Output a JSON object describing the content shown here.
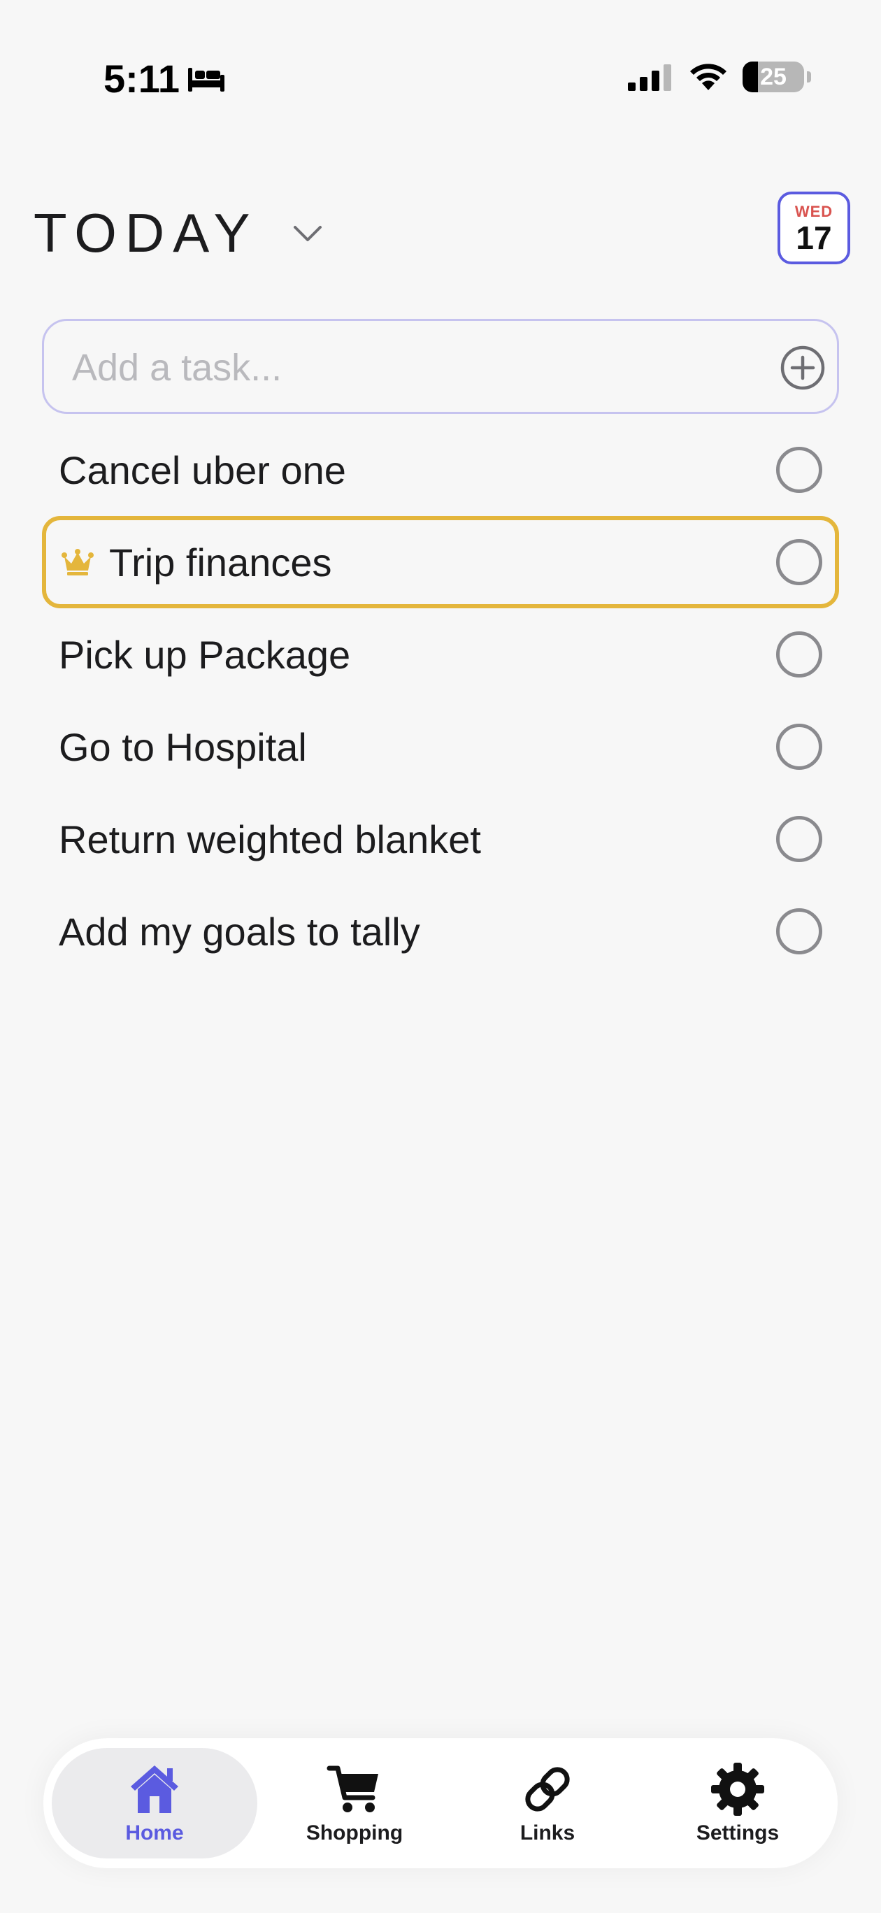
{
  "status_bar": {
    "time": "5:11",
    "battery": "25",
    "battery_level": 0.25
  },
  "header": {
    "title": "TODAY",
    "calendar": {
      "day": "WED",
      "date": "17"
    }
  },
  "add_task": {
    "placeholder": "Add a task..."
  },
  "tasks": [
    {
      "label": "Cancel uber one",
      "highlighted": false
    },
    {
      "label": "Trip finances",
      "highlighted": true
    },
    {
      "label": "Pick up Package",
      "highlighted": false
    },
    {
      "label": "Go to Hospital",
      "highlighted": false
    },
    {
      "label": "Return weighted blanket",
      "highlighted": false
    },
    {
      "label": "Add my goals to tally",
      "highlighted": false
    }
  ],
  "tab_bar": {
    "items": [
      {
        "label": "Home",
        "icon": "house-icon",
        "active": true
      },
      {
        "label": "Shopping",
        "icon": "cart-icon",
        "active": false
      },
      {
        "label": "Links",
        "icon": "link-icon",
        "active": false
      },
      {
        "label": "Settings",
        "icon": "gear-icon",
        "active": false
      }
    ]
  },
  "colors": {
    "accent": "#5b5be0",
    "highlight": "#e4b63c",
    "calendar_day": "#d9534f",
    "background": "#f7f7f7"
  }
}
